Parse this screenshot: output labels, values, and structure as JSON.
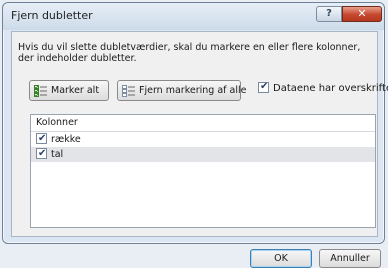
{
  "dialog": {
    "title": "Fjern dubletter",
    "help_glyph": "?",
    "close_glyph": "✕",
    "description": "Hvis du vil slette dubletværdier, skal du markere en eller flere kolonner, der indeholder dubletter.",
    "select_all_label": "Marker alt",
    "unselect_all_label": "Fjern markering af alle",
    "has_headers_label": "Dataene har overskrifter",
    "has_headers_checked": true,
    "list": {
      "header": "Kolonner",
      "columns": [
        {
          "label": "række",
          "checked": true
        },
        {
          "label": "tal",
          "checked": true
        }
      ]
    },
    "ok_label": "OK",
    "cancel_label": "Annuller"
  }
}
